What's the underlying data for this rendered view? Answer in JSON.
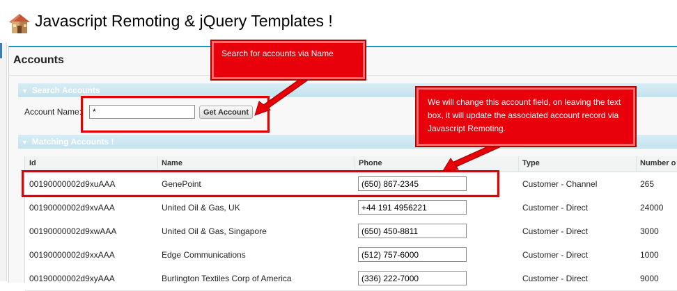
{
  "app": {
    "title": "Javascript Remoting & jQuery Templates !"
  },
  "block": {
    "title": "Accounts"
  },
  "search_section": {
    "header": "Search Accounts",
    "account_label": "Account Name:",
    "account_value": "*",
    "get_button": "Get Account"
  },
  "results_section": {
    "header": "Matching Accounts !"
  },
  "table": {
    "columns": [
      "Id",
      "Name",
      "Phone",
      "Type",
      "Number o"
    ],
    "rows": [
      {
        "id": "00190000002d9xuAAA",
        "name": "GenePoint",
        "phone": "(650) 867-2345",
        "type": "Customer - Channel",
        "num": "265"
      },
      {
        "id": "00190000002d9xvAAA",
        "name": "United Oil & Gas, UK",
        "phone": "+44 191 4956221",
        "type": "Customer - Direct",
        "num": "24000"
      },
      {
        "id": "00190000002d9xwAAA",
        "name": "United Oil & Gas, Singapore",
        "phone": "(650) 450-8811",
        "type": "Customer - Direct",
        "num": "3000"
      },
      {
        "id": "00190000002d9xxAAA",
        "name": "Edge Communications",
        "phone": "(512) 757-6000",
        "type": "Customer - Direct",
        "num": "1000"
      },
      {
        "id": "00190000002d9xyAAA",
        "name": "Burlington Textiles Corp of America",
        "phone": "(336) 222-7000",
        "type": "Customer - Direct",
        "num": "9000"
      }
    ]
  },
  "annotations": {
    "note1": "Search for accounts via Name",
    "note2": "We will change this account field, on leaving the text box, it will update the associated account record via Javascript Remoting."
  },
  "colors": {
    "accent": "#1797c0",
    "annotation_red": "#e8000a",
    "section_header": "#c3e3ee"
  },
  "icons": {
    "app": "house-icon",
    "section_toggle": "triangle-down-icon"
  }
}
